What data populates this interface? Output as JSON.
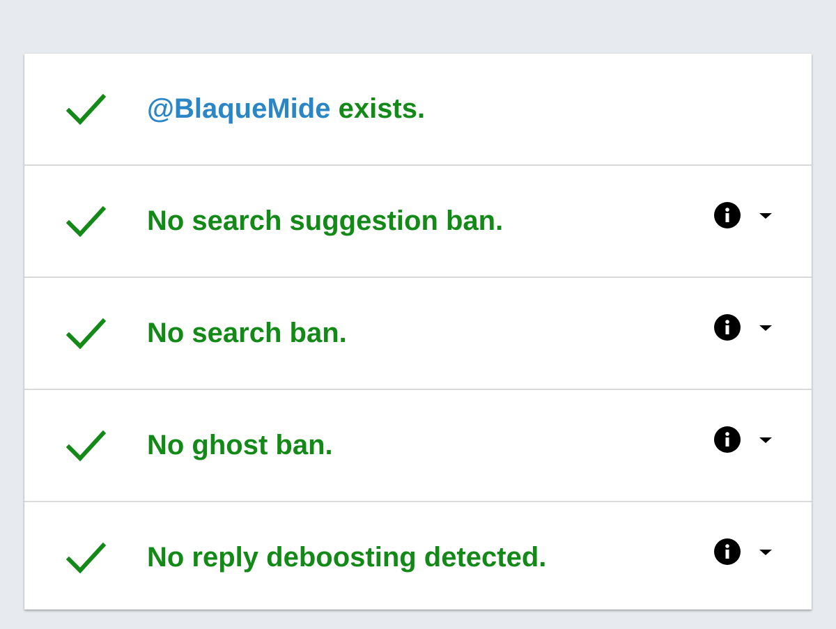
{
  "colors": {
    "page_background": "#e7ebef",
    "card_background": "#ffffff",
    "success_green": "#138a18",
    "handle_blue": "#2a86c5",
    "divider": "#d9d9d9",
    "icon_black": "#000000"
  },
  "checks": [
    {
      "status_icon": "checkmark-icon",
      "handle": "@BlaqueMide",
      "label": " exists.",
      "has_details": false
    },
    {
      "status_icon": "checkmark-icon",
      "label": "No search suggestion ban.",
      "has_details": true,
      "info_icon": "info-icon",
      "expand_icon": "caret-down-icon"
    },
    {
      "status_icon": "checkmark-icon",
      "label": "No search ban.",
      "has_details": true,
      "info_icon": "info-icon",
      "expand_icon": "caret-down-icon"
    },
    {
      "status_icon": "checkmark-icon",
      "label": "No ghost ban.",
      "has_details": true,
      "info_icon": "info-icon",
      "expand_icon": "caret-down-icon"
    },
    {
      "status_icon": "checkmark-icon",
      "label": "No reply deboosting detected.",
      "has_details": true,
      "info_icon": "info-icon",
      "expand_icon": "caret-down-icon"
    }
  ]
}
